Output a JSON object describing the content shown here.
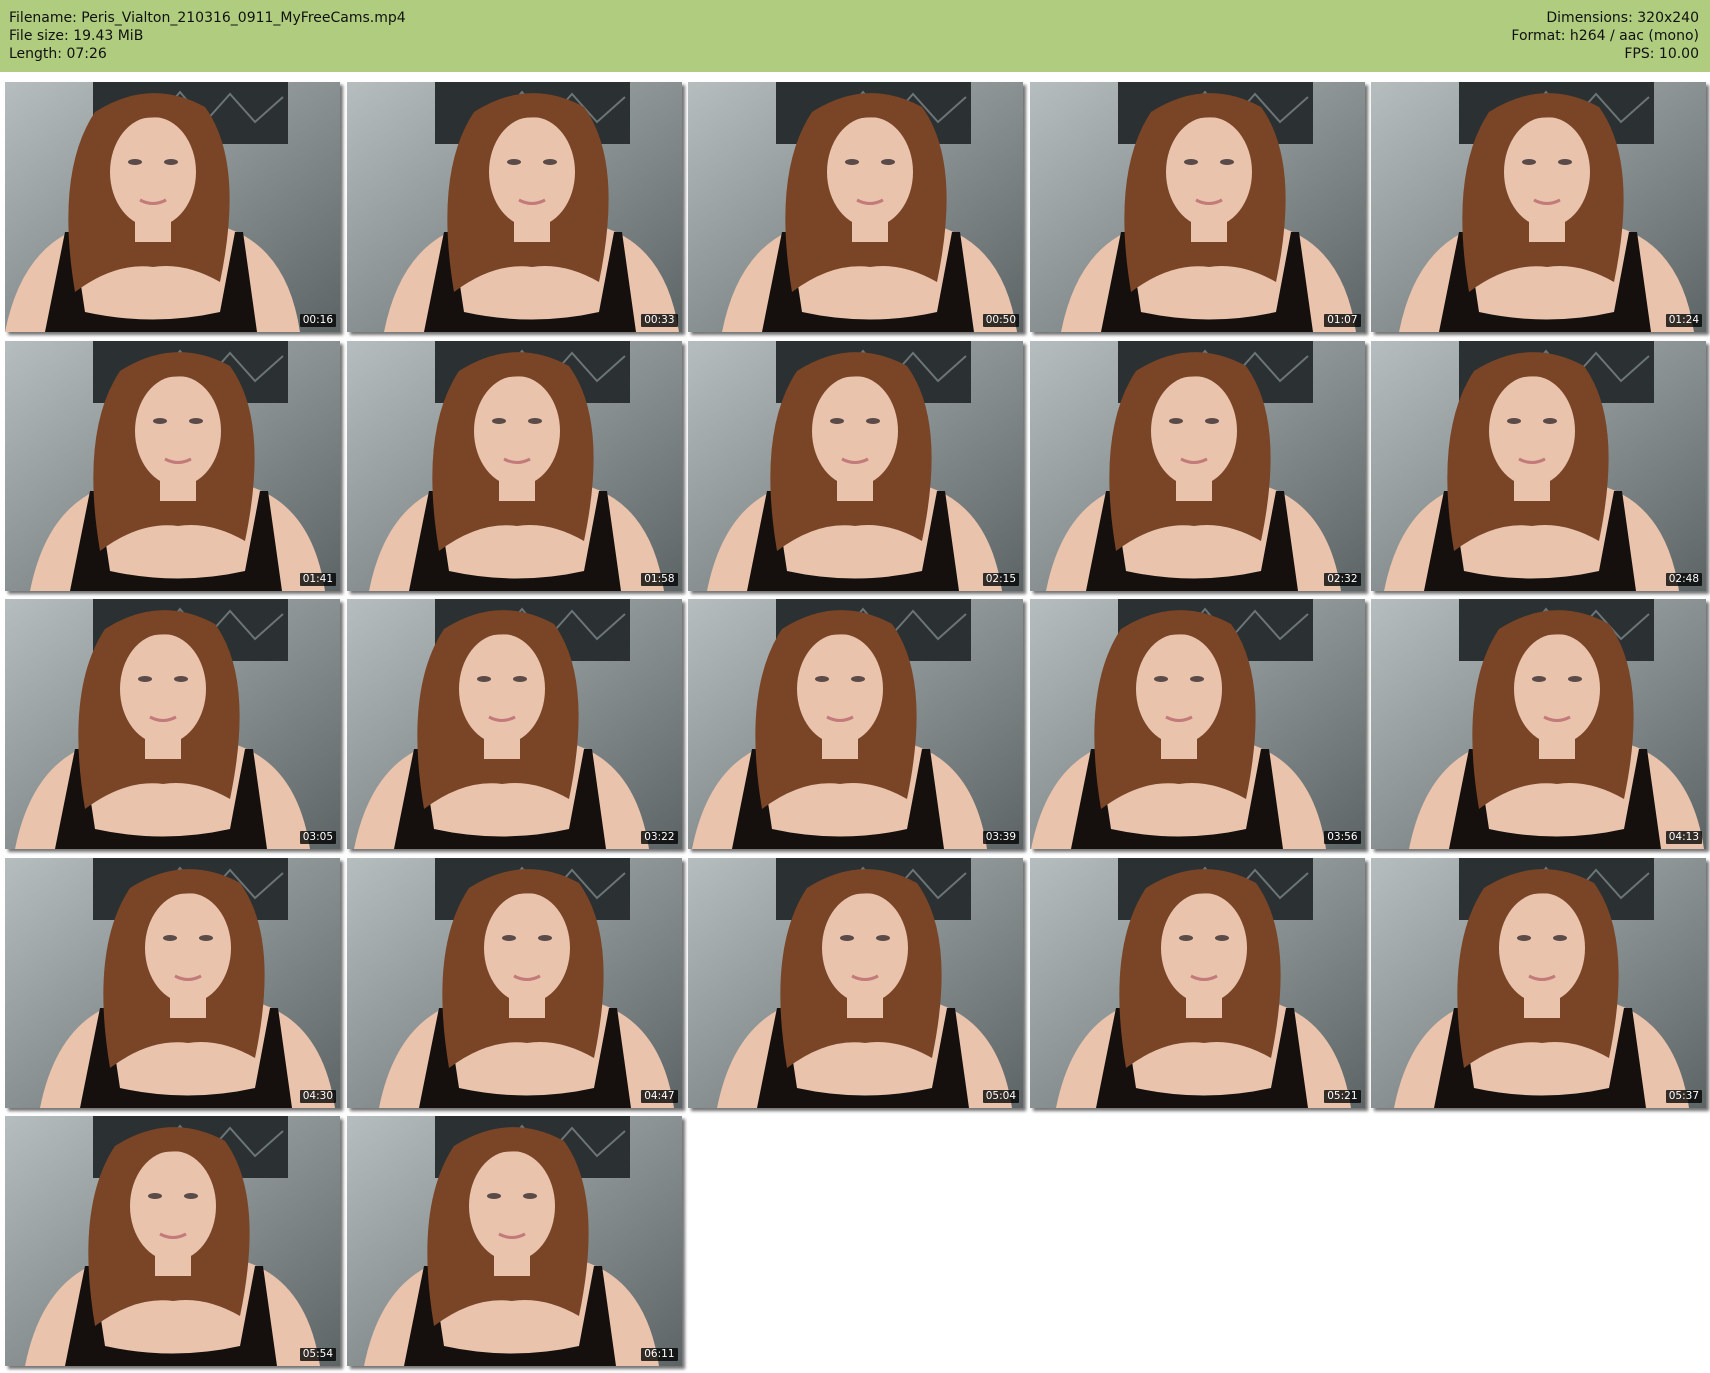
{
  "header": {
    "filename_line": "Filename: Peris_Vialton_210316_0911_MyFreeCams.mp4",
    "filesize_line": "File size: 19.43 MiB",
    "length_line": "Length: 07:26",
    "dimensions_line": "Dimensions: 320x240",
    "format_line": "Format: h264 / aac (mono)",
    "fps_line": "FPS: 10.00"
  },
  "colors": {
    "header_bg": "#b0cd7f",
    "wall": "#8f9a9c",
    "hair": "#7a4526",
    "skin": "#e9c3ac",
    "top": "#15100e",
    "poster": "#2b3032"
  },
  "thumbnails": [
    {
      "time": "00:16"
    },
    {
      "time": "00:33"
    },
    {
      "time": "00:50"
    },
    {
      "time": "01:07"
    },
    {
      "time": "01:24"
    },
    {
      "time": "01:41"
    },
    {
      "time": "01:58"
    },
    {
      "time": "02:15"
    },
    {
      "time": "02:32"
    },
    {
      "time": "02:48"
    },
    {
      "time": "03:05"
    },
    {
      "time": "03:22"
    },
    {
      "time": "03:39"
    },
    {
      "time": "03:56"
    },
    {
      "time": "04:13"
    },
    {
      "time": "04:30"
    },
    {
      "time": "04:47"
    },
    {
      "time": "05:04"
    },
    {
      "time": "05:21"
    },
    {
      "time": "05:37"
    },
    {
      "time": "05:54"
    },
    {
      "time": "06:11"
    }
  ]
}
